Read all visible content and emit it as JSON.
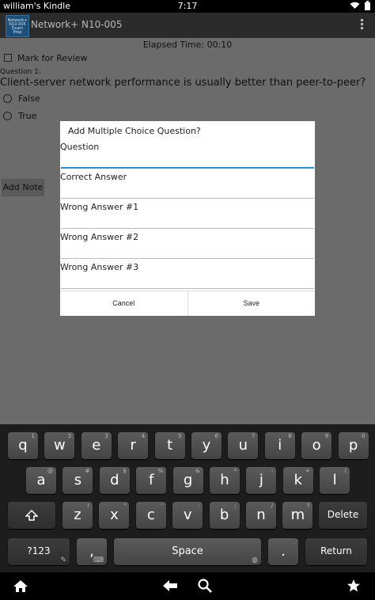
{
  "status": {
    "device_name": "william's Kindle",
    "time": "7:17",
    "wifi_icon": "wifi-icon",
    "battery_icon": "battery-icon"
  },
  "app": {
    "logo_lines": [
      "Network+",
      "N10-005",
      "Exam",
      "Prep"
    ],
    "title": "Network+ N10-005",
    "elapsed": "Elapsed Time: 00:10",
    "mark_for_review": "Mark for Review",
    "question_number": "Question 1:",
    "question_text": "Client-server network performance is usually better than peer-to-peer?",
    "options": [
      "False",
      "True"
    ],
    "add_note": "Add Note"
  },
  "dialog": {
    "title": "Add Multiple Choice Question?",
    "fields": [
      {
        "label": "Question",
        "value": ""
      },
      {
        "label": "Correct Answer",
        "value": ""
      },
      {
        "label": "Wrong Answer #1",
        "value": ""
      },
      {
        "label": "Wrong Answer #2",
        "value": ""
      },
      {
        "label": "Wrong Answer #3",
        "value": ""
      }
    ],
    "cancel": "Cancel",
    "save": "Save"
  },
  "keyboard": {
    "row1": [
      {
        "k": "q",
        "h": "1"
      },
      {
        "k": "w",
        "h": "2"
      },
      {
        "k": "e",
        "h": "3"
      },
      {
        "k": "r",
        "h": "4"
      },
      {
        "k": "t",
        "h": "5"
      },
      {
        "k": "y",
        "h": "6"
      },
      {
        "k": "u",
        "h": "7"
      },
      {
        "k": "i",
        "h": "8"
      },
      {
        "k": "o",
        "h": "9"
      },
      {
        "k": "p",
        "h": "0"
      }
    ],
    "row2": [
      {
        "k": "a",
        "h": "@"
      },
      {
        "k": "s",
        "h": "#"
      },
      {
        "k": "d",
        "h": "$"
      },
      {
        "k": "f",
        "h": "%"
      },
      {
        "k": "g",
        "h": "&"
      },
      {
        "k": "h",
        "h": "*"
      },
      {
        "k": "j",
        "h": "-"
      },
      {
        "k": "k",
        "h": "+"
      },
      {
        "k": "l",
        "h": "("
      }
    ],
    "row3": [
      {
        "k": "z",
        "h": "!"
      },
      {
        "k": "x",
        "h": "\""
      },
      {
        "k": "c",
        "h": "'"
      },
      {
        "k": "v",
        "h": ":"
      },
      {
        "k": "b",
        "h": ";"
      },
      {
        "k": "n",
        "h": "/"
      },
      {
        "k": "m",
        "h": "?"
      }
    ],
    "delete": "Delete",
    "symbols": "?123",
    "comma": ",",
    "space": "Space",
    "period": ".",
    "return": "Return"
  },
  "nav": {
    "home_icon": "home-icon",
    "back_icon": "back-arrow-icon",
    "search_icon": "search-icon",
    "favorites_icon": "star-icon"
  }
}
